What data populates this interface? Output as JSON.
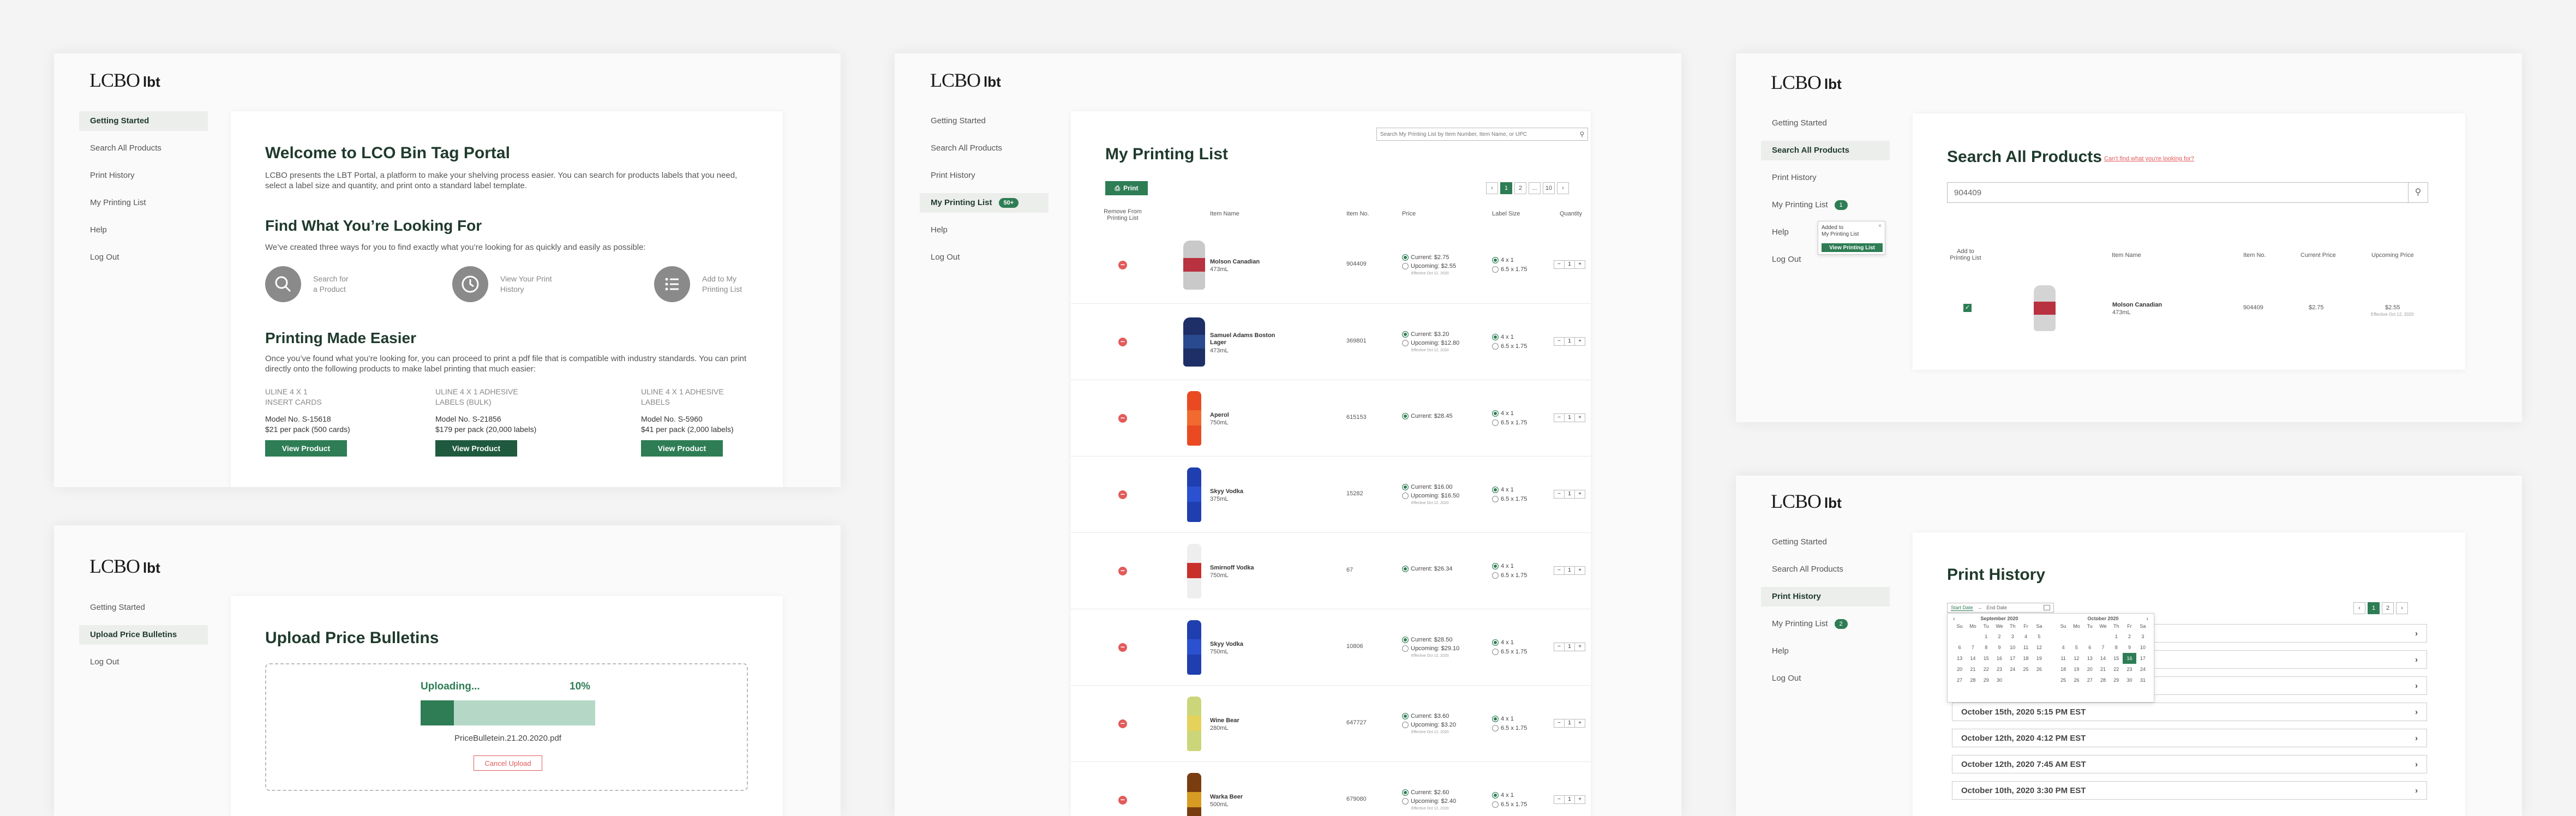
{
  "brand": {
    "logo_main": "LCBO",
    "logo_sub": "lbt",
    "accent": "#2e7d55",
    "accent_dark": "#1f5a3e",
    "danger": "#e25b5b"
  },
  "nav_labels": {
    "getting_started": "Getting Started",
    "search": "Search All Products",
    "history": "Print History",
    "list": "My Printing List",
    "help": "Help",
    "logout": "Log Out",
    "upload": "Upload Price Bulletins"
  },
  "home": {
    "title": "Welcome to LCO Bin Tag Portal",
    "intro": "LCBO presents the LBT Portal, a platform to make your shelving process easier. You can search for products labels that you need, select a label size and quantity, and print onto a standard label template.",
    "find_title": "Find What You’re Looking For",
    "find_text": "We’ve created three ways for you to find exactly what you’re looking for as quickly and easily as possible:",
    "ways": [
      {
        "icon": "search-icon",
        "label": "Search for\na Product"
      },
      {
        "icon": "clock-icon",
        "label": "View Your Print\nHistory"
      },
      {
        "icon": "list-icon",
        "label": "Add to My\nPrinting List"
      }
    ],
    "print_title": "Printing Made Easier",
    "print_text": "Once you’ve found what you’re looking for, you can proceed to print a pdf file that is compatible with industry standards. You can print directly onto the following products to make label printing that much easier:",
    "products": [
      {
        "name": "ULINE 4 X 1\nINSERT CARDS",
        "model": "Model No. S-15618",
        "price": "$21 per pack (500 cards)",
        "button": "View Product"
      },
      {
        "name": "ULINE 4 X 1 ADHESIVE\nLABELS (BULK)",
        "model": "Model No. S-21856",
        "price": "$179 per pack (20,000 labels)",
        "button": "View Product"
      },
      {
        "name": "ULINE 4 X 1 ADHESIVE\nLABELS",
        "model": "Model No. S-5960",
        "price": "$41 per pack (2,000 labels)",
        "button": "View Product"
      }
    ]
  },
  "upload": {
    "title": "Upload Price Bulletins",
    "status": "Uploading...",
    "percent": "10%",
    "progress": 0.19,
    "filename": "PriceBulletein.21.20.2020.pdf",
    "cancel": "Cancel Upload"
  },
  "printing_list": {
    "title": "My Printing List",
    "badge": "50+",
    "search_placeholder": "Search My Printing List by Item Number, Item Name, or UPC",
    "print_button": "Print",
    "pager": [
      "‹",
      "1",
      "2",
      "...",
      "10",
      "›"
    ],
    "headers": [
      "Remove From\nPrinting List",
      "Item Name",
      "Item No.",
      "Price",
      "Label Size",
      "Quantity"
    ],
    "items": [
      {
        "name": "Molson Canadian",
        "size": "473mL",
        "no": "904409",
        "current": "Current: $2.75",
        "upcoming": "Upcoming: $2.55",
        "eff": "Effective Oct 12, 2020",
        "qty": "1",
        "color": "#c9c9c9",
        "band": "#b8323f",
        "cur_sel": true
      },
      {
        "name": "Samuel Adams Boston\nLager",
        "size": "473mL",
        "no": "369801",
        "current": "Current: $3.20",
        "upcoming": "Upcoming: $12.80",
        "eff": "Effective Oct 12, 2020",
        "qty": "1",
        "color": "#1d2f66",
        "band": "#2a4a8f",
        "cur_sel": true
      },
      {
        "name": "Aperol",
        "size": "750mL",
        "no": "615153",
        "current": "Current: $28.45",
        "upcoming": "",
        "eff": "",
        "qty": "1",
        "color": "#e94a22",
        "band": "#f16a2f",
        "cur_sel": true
      },
      {
        "name": "Skyy Vodka",
        "size": "375mL",
        "no": "15282",
        "current": "Current: $16.00",
        "upcoming": "Upcoming: $16.50",
        "eff": "Effective Oct 12, 2020",
        "qty": "1",
        "color": "#1f3fb0",
        "band": "#2b50d0",
        "cur_sel": true
      },
      {
        "name": "Smirnoff Vodka",
        "size": "750mL",
        "no": "67",
        "current": "Current: $26.34",
        "upcoming": "",
        "eff": "",
        "qty": "1",
        "color": "#eeeeee",
        "band": "#c9302c",
        "cur_sel": true
      },
      {
        "name": "Skyy Vodka",
        "size": "750mL",
        "no": "10806",
        "current": "Current: $28.50",
        "upcoming": "Upcoming: $29.10",
        "eff": "Effective Oct 12, 2020",
        "qty": "1",
        "color": "#1f3fb0",
        "band": "#2b50d0",
        "cur_sel": true
      },
      {
        "name": "Wine Bear",
        "size": "280mL",
        "no": "647727",
        "current": "Current: $3.60",
        "upcoming": "Upcoming: $3.20",
        "eff": "Effective Oct 12, 2020",
        "qty": "1",
        "color": "#cbd67a",
        "band": "#e4d25a",
        "cur_sel": true
      },
      {
        "name": "Warka Beer",
        "size": "500mL",
        "no": "679080",
        "current": "Current: $2.60",
        "upcoming": "Upcoming: $2.40",
        "eff": "Effective Oct 12, 2020",
        "qty": "1",
        "color": "#7a3d10",
        "band": "#d79b22",
        "cur_sel": true
      }
    ],
    "label_sizes": [
      "4 x 1",
      "6.5 x 1.75"
    ]
  },
  "search": {
    "title": "Search All Products",
    "hint": "Can't find what you're looking for?",
    "query": "904409",
    "badge": "1",
    "popup": {
      "line": "Added to\nMy Printing List",
      "button": "View Printing List"
    },
    "headers": [
      "Add to\nPrinting List",
      "Item Name",
      "Item No.",
      "Current Price",
      "Upcoming Price"
    ],
    "row": {
      "name": "Molson Canadian",
      "size": "473mL",
      "no": "904409",
      "current": "$2.75",
      "upcoming": "$2.55",
      "eff": "Effective Oct 12, 2020"
    }
  },
  "history": {
    "title": "Print History",
    "badge": "2",
    "start": "Start Date",
    "arrow": "→",
    "end": "End Date",
    "pager": [
      "‹",
      "1",
      "2",
      "›"
    ],
    "rows": [
      "October 15th, 2020 5:15 PM EST",
      "October 12th, 2020 4:12 PM EST",
      "October 12th, 2020 7:45 AM EST",
      "October 10th, 2020 3:30 PM EST"
    ],
    "calendars": [
      {
        "month": "September 2020",
        "days": [
          "Su",
          "Mo",
          "Tu",
          "We",
          "Th",
          "Fr",
          "Sa"
        ],
        "weeks": [
          [
            "",
            "",
            "1",
            "2",
            "3",
            "4",
            "5"
          ],
          [
            "6",
            "7",
            "8",
            "9",
            "10",
            "11",
            "12"
          ],
          [
            "13",
            "14",
            "15",
            "16",
            "17",
            "18",
            "19"
          ],
          [
            "20",
            "21",
            "22",
            "23",
            "24",
            "25",
            "26"
          ],
          [
            "27",
            "28",
            "29",
            "30",
            "",
            "",
            ""
          ]
        ]
      },
      {
        "month": "October 2020",
        "days": [
          "Su",
          "Mo",
          "Tu",
          "We",
          "Th",
          "Fr",
          "Sa"
        ],
        "weeks": [
          [
            "",
            "",
            "",
            "",
            "1",
            "2",
            "3"
          ],
          [
            "4",
            "5",
            "6",
            "7",
            "8",
            "9",
            "10"
          ],
          [
            "11",
            "12",
            "13",
            "14",
            "15",
            "16",
            "17"
          ],
          [
            "18",
            "19",
            "20",
            "21",
            "22",
            "23",
            "24"
          ],
          [
            "25",
            "26",
            "27",
            "28",
            "29",
            "30",
            "31"
          ]
        ]
      }
    ]
  }
}
